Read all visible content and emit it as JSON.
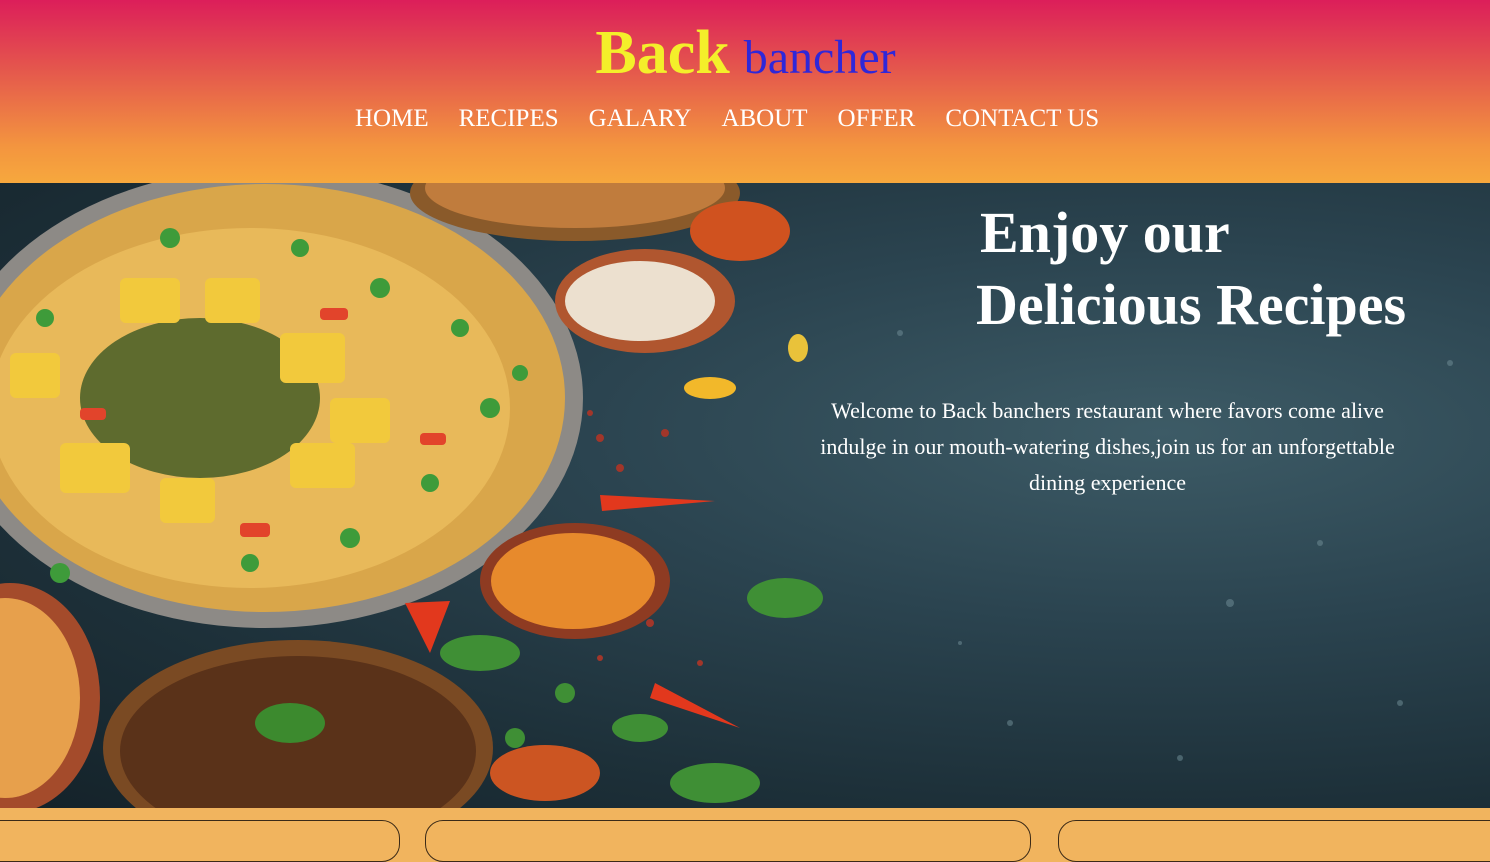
{
  "brand": {
    "part1": "Back",
    "part2": "bancher"
  },
  "nav": {
    "items": [
      {
        "label": "HOME"
      },
      {
        "label": "RECIPES"
      },
      {
        "label": "GALARY"
      },
      {
        "label": "ABOUT"
      },
      {
        "label": "OFFER"
      },
      {
        "label": "CONTACT US"
      }
    ]
  },
  "hero": {
    "title_line1": "Enjoy our",
    "title_line2": "Delicious Recipes",
    "text": "Welcome to Back banchers restaurant where favors come alive indulge in our mouth-watering dishes,join us for an unforgettable dining experience",
    "image": "food-spread-image"
  },
  "colors": {
    "header_top": "#dc1e5a",
    "header_bottom": "#f7a83d",
    "brand_yellow": "#f4ef2a",
    "brand_blue": "#2f27d9",
    "page_bg": "#f1b45e"
  }
}
